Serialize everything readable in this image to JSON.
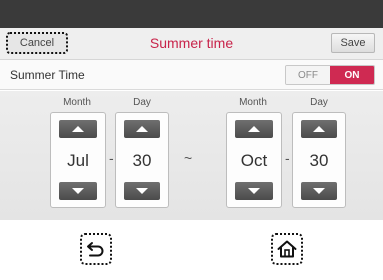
{
  "header": {
    "cancel_label": "Cancel",
    "title": "Summer time",
    "save_label": "Save"
  },
  "summer_time_row": {
    "label": "Summer Time",
    "toggle": {
      "off_label": "OFF",
      "on_label": "ON",
      "selected": "ON"
    }
  },
  "start": {
    "month_label": "Month",
    "day_label": "Day",
    "month_value": "Jul",
    "day_value": "30"
  },
  "end": {
    "month_label": "Month",
    "day_label": "Day",
    "month_value": "Oct",
    "day_value": "30"
  },
  "separators": {
    "dash": "-",
    "range": "~"
  },
  "bottom_nav": {
    "back_icon": "back-return-icon",
    "home_icon": "home-icon"
  },
  "colors": {
    "accent": "#cf2a52",
    "title": "#c8234a",
    "top_bar": "#3a3a3a"
  }
}
